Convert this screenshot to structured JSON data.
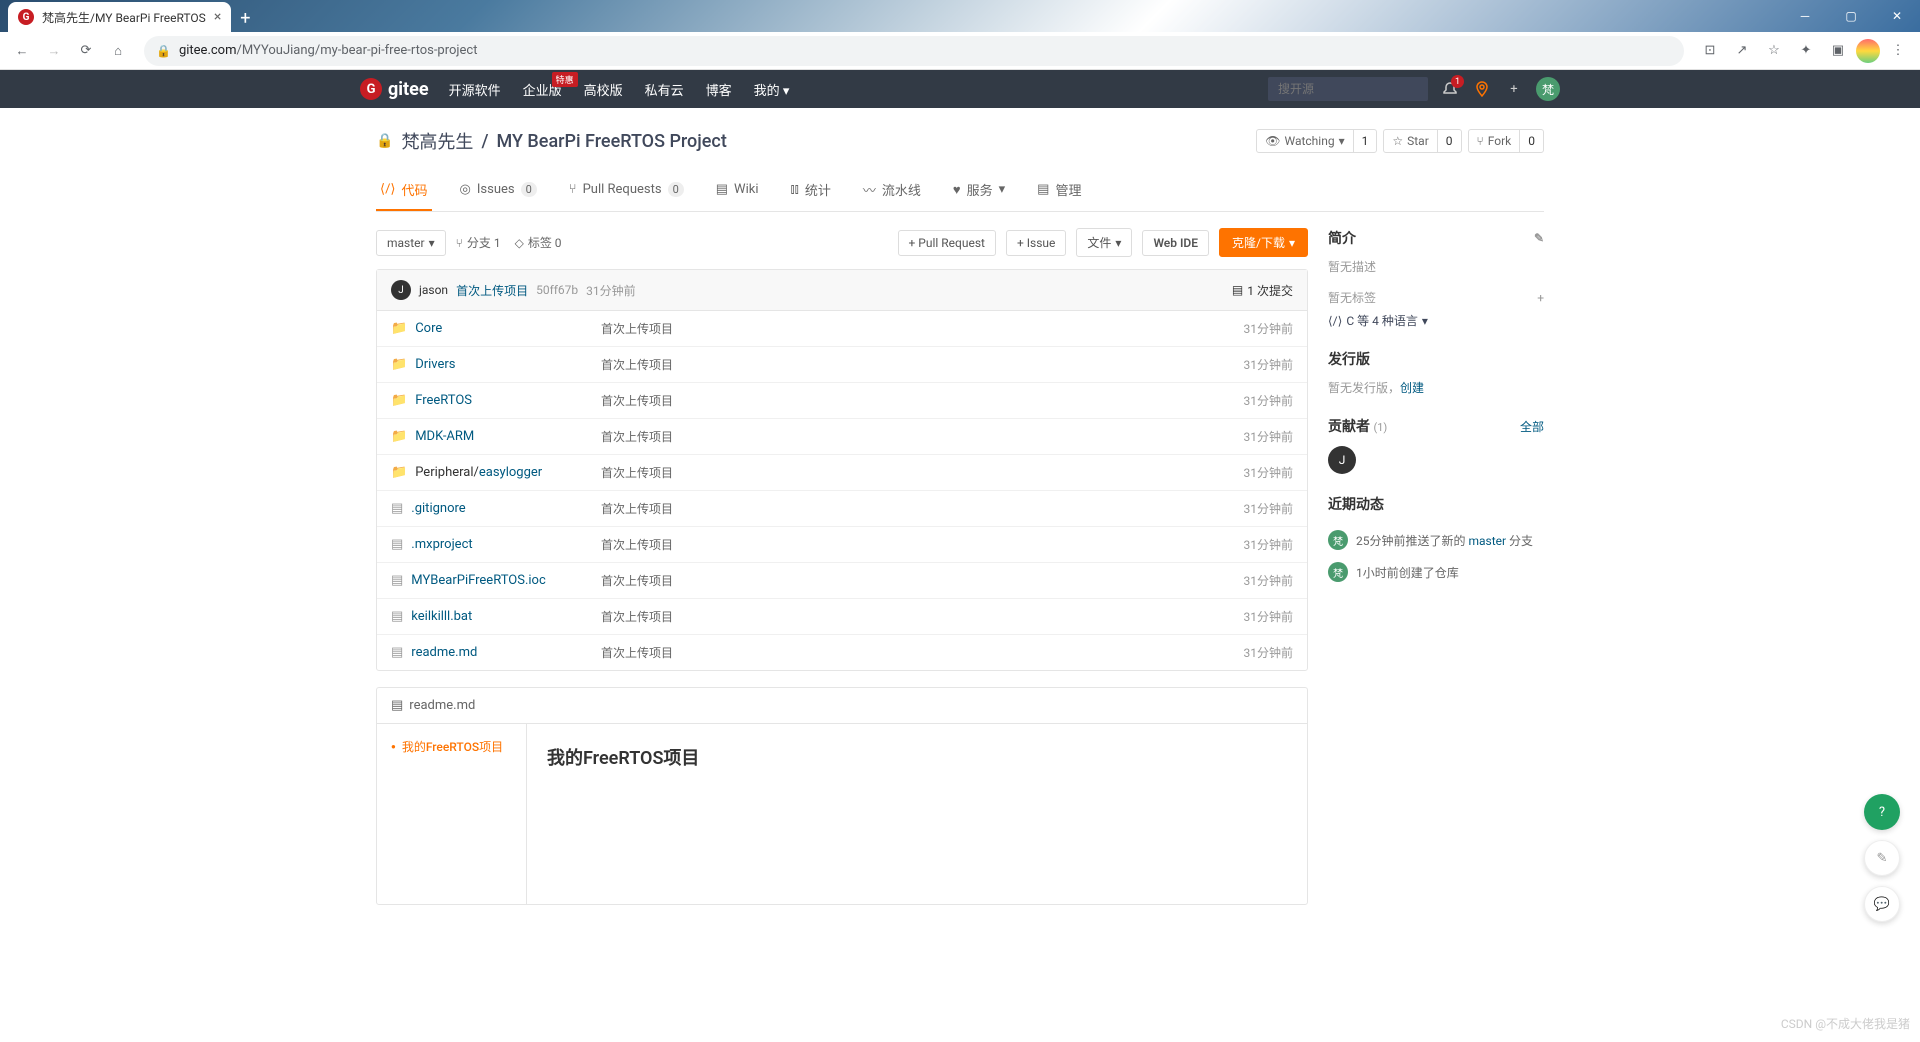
{
  "browser": {
    "tab_title": "梵高先生/MY BearPi FreeRTOS",
    "url_host": "gitee.com",
    "url_path": "/MYYouJiang/my-bear-pi-free-rtos-project"
  },
  "header": {
    "logo": "gitee",
    "nav": {
      "opensource": "开源软件",
      "enterprise": "企业版",
      "enterprise_badge": "特惠",
      "university": "高校版",
      "private": "私有云",
      "blog": "博客",
      "mine": "我的"
    },
    "search_placeholder": "搜开源",
    "notif_count": "1",
    "user_char": "梵"
  },
  "repo": {
    "owner": "梵高先生",
    "name": "MY BearPi FreeRTOS Project",
    "separator": " / ",
    "stats": {
      "watching": "Watching",
      "watching_count": "1",
      "star": "Star",
      "star_count": "0",
      "fork": "Fork",
      "fork_count": "0"
    },
    "tabs": {
      "code": "代码",
      "issues": "Issues",
      "issues_count": "0",
      "pr": "Pull Requests",
      "pr_count": "0",
      "wiki": "Wiki",
      "stats": "统计",
      "pipeline": "流水线",
      "services": "服务",
      "manage": "管理"
    }
  },
  "toolbar": {
    "branch": "master",
    "branches": "分支 1",
    "tags": "标签 0",
    "pull_request": "+ Pull Request",
    "issue": "+ Issue",
    "file": "文件",
    "web_ide": "Web IDE",
    "clone": "克隆/下载"
  },
  "commit": {
    "author_char": "J",
    "author": "jason",
    "message": "首次上传项目",
    "hash": "50ff67b",
    "time": "31分钟前",
    "count_label": "1 次提交"
  },
  "files": [
    {
      "name": "Core",
      "type": "folder",
      "commit": "首次上传项目",
      "time": "31分钟前"
    },
    {
      "name": "Drivers",
      "type": "folder",
      "commit": "首次上传项目",
      "time": "31分钟前"
    },
    {
      "name": "FreeRTOS",
      "type": "folder",
      "commit": "首次上传项目",
      "time": "31分钟前"
    },
    {
      "name": "MDK-ARM",
      "type": "folder",
      "commit": "首次上传项目",
      "time": "31分钟前"
    },
    {
      "name": "Peripheral/",
      "sub": "easylogger",
      "type": "folder",
      "commit": "首次上传项目",
      "time": "31分钟前"
    },
    {
      "name": ".gitignore",
      "type": "file",
      "commit": "首次上传项目",
      "time": "31分钟前"
    },
    {
      "name": ".mxproject",
      "type": "file",
      "commit": "首次上传项目",
      "time": "31分钟前"
    },
    {
      "name": "MYBearPiFreeRTOS.ioc",
      "type": "file",
      "commit": "首次上传项目",
      "time": "31分钟前"
    },
    {
      "name": "keilkilll.bat",
      "type": "file",
      "commit": "首次上传项目",
      "time": "31分钟前"
    },
    {
      "name": "readme.md",
      "type": "file",
      "commit": "首次上传项目",
      "time": "31分钟前"
    }
  ],
  "readme": {
    "filename": "readme.md",
    "toc_item": "我的FreeRTOS项目",
    "heading": "我的FreeRTOS项目"
  },
  "sidebar": {
    "intro_title": "简介",
    "no_desc": "暂无描述",
    "no_tags": "暂无标签",
    "languages": "C 等 4 种语言",
    "release_title": "发行版",
    "no_release": "暂无发行版，",
    "create": "创建",
    "contributors_title": "贡献者",
    "contributors_count": "(1)",
    "all": "全部",
    "contributor_char": "J",
    "activity_title": "近期动态",
    "activities": [
      {
        "time": "25分钟前",
        "action": "推送了新的 ",
        "target": "master",
        "suffix": " 分支"
      },
      {
        "time": "1小时前",
        "action": "创建了仓库",
        "target": "",
        "suffix": ""
      }
    ]
  },
  "watermark": "CSDN @不成大佬我是猪"
}
